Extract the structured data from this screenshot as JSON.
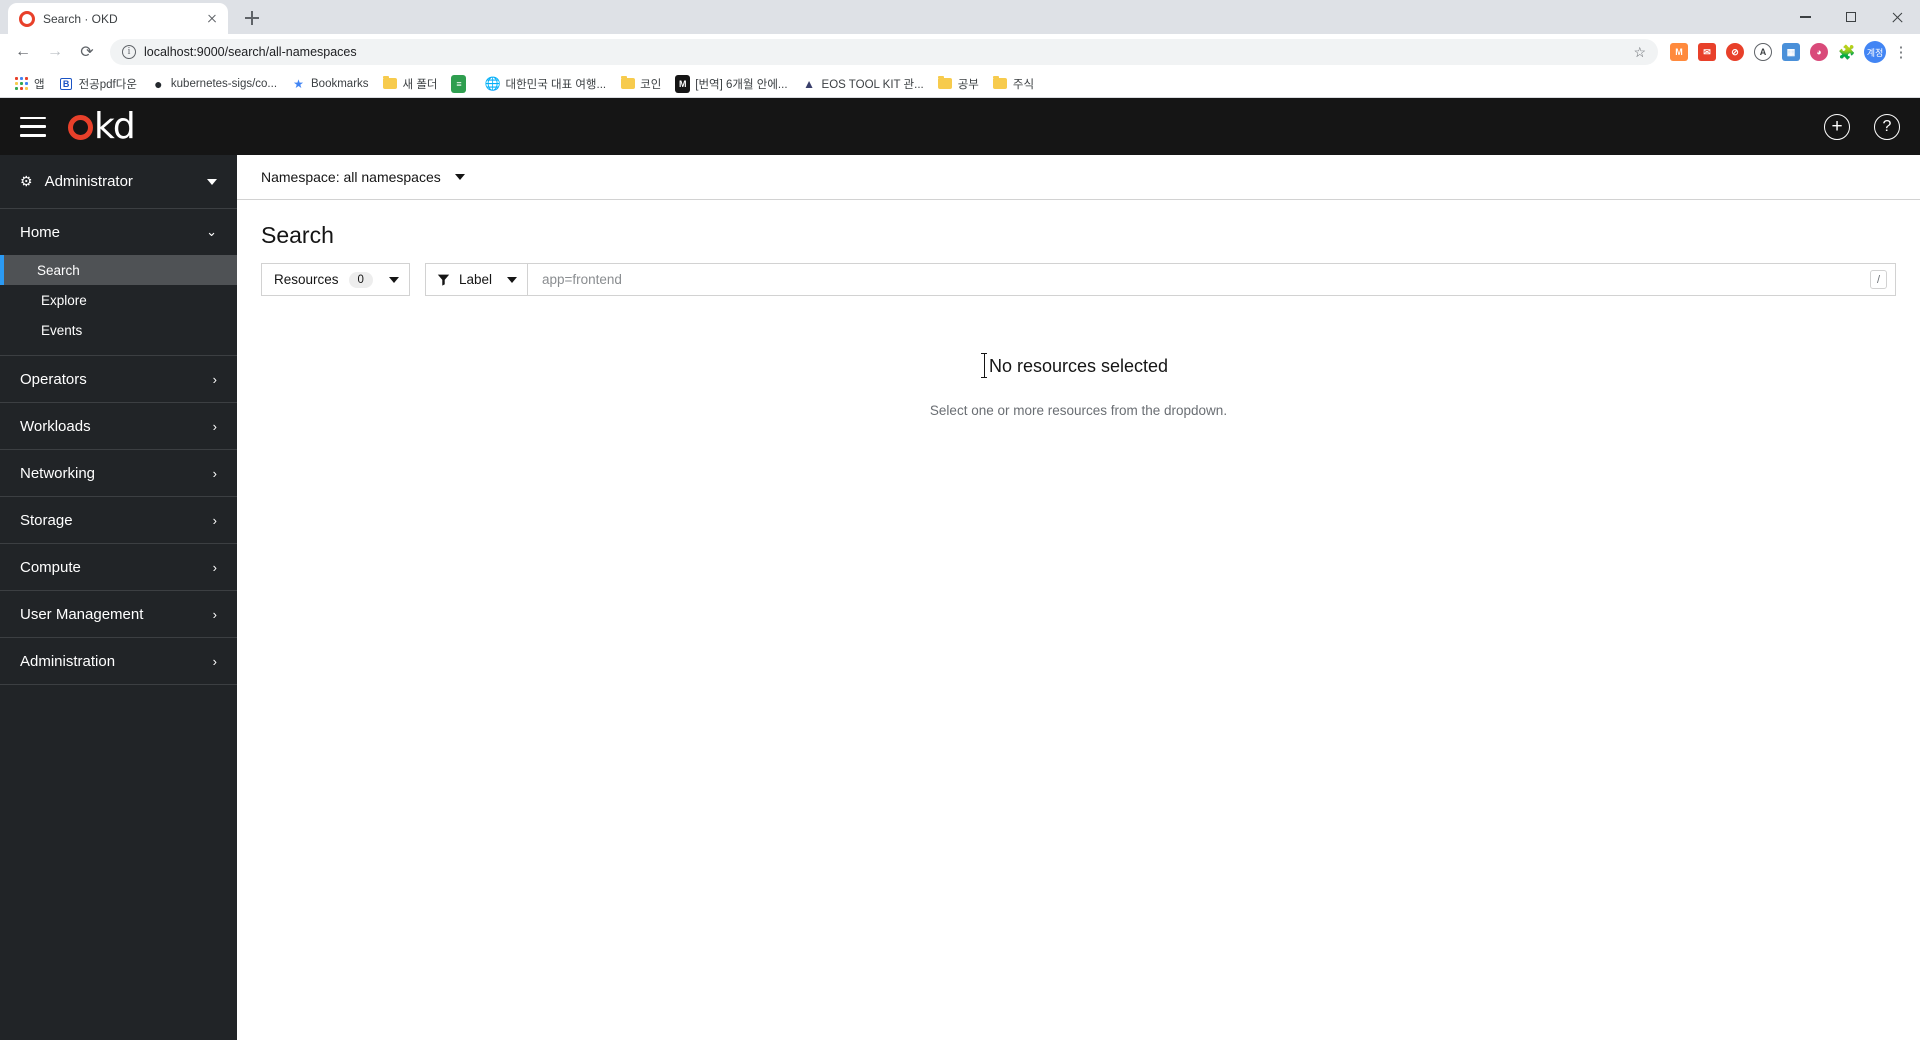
{
  "browser": {
    "tab": {
      "title": "Search · OKD",
      "favicon": "okd-circle-icon",
      "close_icon": "close-icon"
    },
    "new_tab_label": "+",
    "nav": {
      "back": "←",
      "forward": "→",
      "reload": "⟳"
    },
    "omnibox": {
      "url": "localhost:9000/search/all-namespaces",
      "info_icon": "info-icon",
      "star_icon": "bookmark-star-icon"
    },
    "toolbar_icons": [
      "extension-m-icon",
      "mail-icon",
      "adblock-icon",
      "grammarly-icon",
      "app-icon",
      "color-icon",
      "puzzle-icon"
    ],
    "profile_initial": "계정",
    "menu_icon": "⋮",
    "window": {
      "minimize": "minimize-icon",
      "maximize": "maximize-icon",
      "close": "close-icon"
    },
    "bookmarks": [
      {
        "label": "앱",
        "icon": "apps-grid-icon"
      },
      {
        "label": "전공pdf다운",
        "icon": "blue-b-icon"
      },
      {
        "label": "kubernetes-sigs/co...",
        "icon": "github-icon"
      },
      {
        "label": "Bookmarks",
        "icon": "star-icon"
      },
      {
        "label": "새 폴더",
        "icon": "folder-icon"
      },
      {
        "label": "",
        "icon": "green-icon"
      },
      {
        "label": "대한민국 대표 여행...",
        "icon": "globe-icon"
      },
      {
        "label": "코인",
        "icon": "folder-icon"
      },
      {
        "label": "[번역] 6개월 안에...",
        "icon": "medium-m-icon"
      },
      {
        "label": "EOS TOOL KIT 관...",
        "icon": "triangle-icon"
      },
      {
        "label": "공부",
        "icon": "folder-icon"
      },
      {
        "label": "주식",
        "icon": "folder-icon"
      }
    ]
  },
  "okd": {
    "masthead": {
      "menu_icon": "hamburger-icon",
      "logo_o": "o",
      "logo_kd": "kd",
      "plus_icon": "plus-circle-icon",
      "help_icon": "help-circle-icon",
      "help_glyph": "?"
    },
    "sidebar": {
      "perspective": {
        "label": "Administrator",
        "icon": "gears-icon",
        "caret": "caret-down-icon"
      },
      "sections": [
        {
          "label": "Home",
          "expanded": true,
          "chevron": "chevron-down-icon",
          "items": [
            {
              "label": "Search",
              "active": true
            },
            {
              "label": "Explore",
              "active": false
            },
            {
              "label": "Events",
              "active": false
            }
          ]
        },
        {
          "label": "Operators",
          "expanded": false,
          "chevron": "chevron-right-icon",
          "items": []
        },
        {
          "label": "Workloads",
          "expanded": false,
          "chevron": "chevron-right-icon",
          "items": []
        },
        {
          "label": "Networking",
          "expanded": false,
          "chevron": "chevron-right-icon",
          "items": []
        },
        {
          "label": "Storage",
          "expanded": false,
          "chevron": "chevron-right-icon",
          "items": []
        },
        {
          "label": "Compute",
          "expanded": false,
          "chevron": "chevron-right-icon",
          "items": []
        },
        {
          "label": "User Management",
          "expanded": false,
          "chevron": "chevron-right-icon",
          "items": []
        },
        {
          "label": "Administration",
          "expanded": false,
          "chevron": "chevron-right-icon",
          "items": []
        }
      ]
    },
    "main": {
      "namespace_bar": {
        "label": "Namespace: all namespaces",
        "caret": "caret-down-icon"
      },
      "title": "Search",
      "filters": {
        "resources": {
          "label": "Resources",
          "count": "0",
          "caret": "caret-down-icon"
        },
        "label_dropdown": {
          "label": "Label",
          "icon": "filter-funnel-icon",
          "caret": "caret-down-icon"
        },
        "label_input": {
          "value": "",
          "placeholder": "app=frontend",
          "shortcut_hint": "/"
        }
      },
      "empty_state": {
        "title": "No resources selected",
        "subtitle": "Select one or more resources from the dropdown."
      }
    }
  },
  "colors": {
    "accent_blue": "#2b9af3",
    "okd_red": "#e8402a",
    "sidebar_bg": "#212427",
    "masthead_bg": "#151515",
    "active_item_bg": "#4f5255"
  }
}
